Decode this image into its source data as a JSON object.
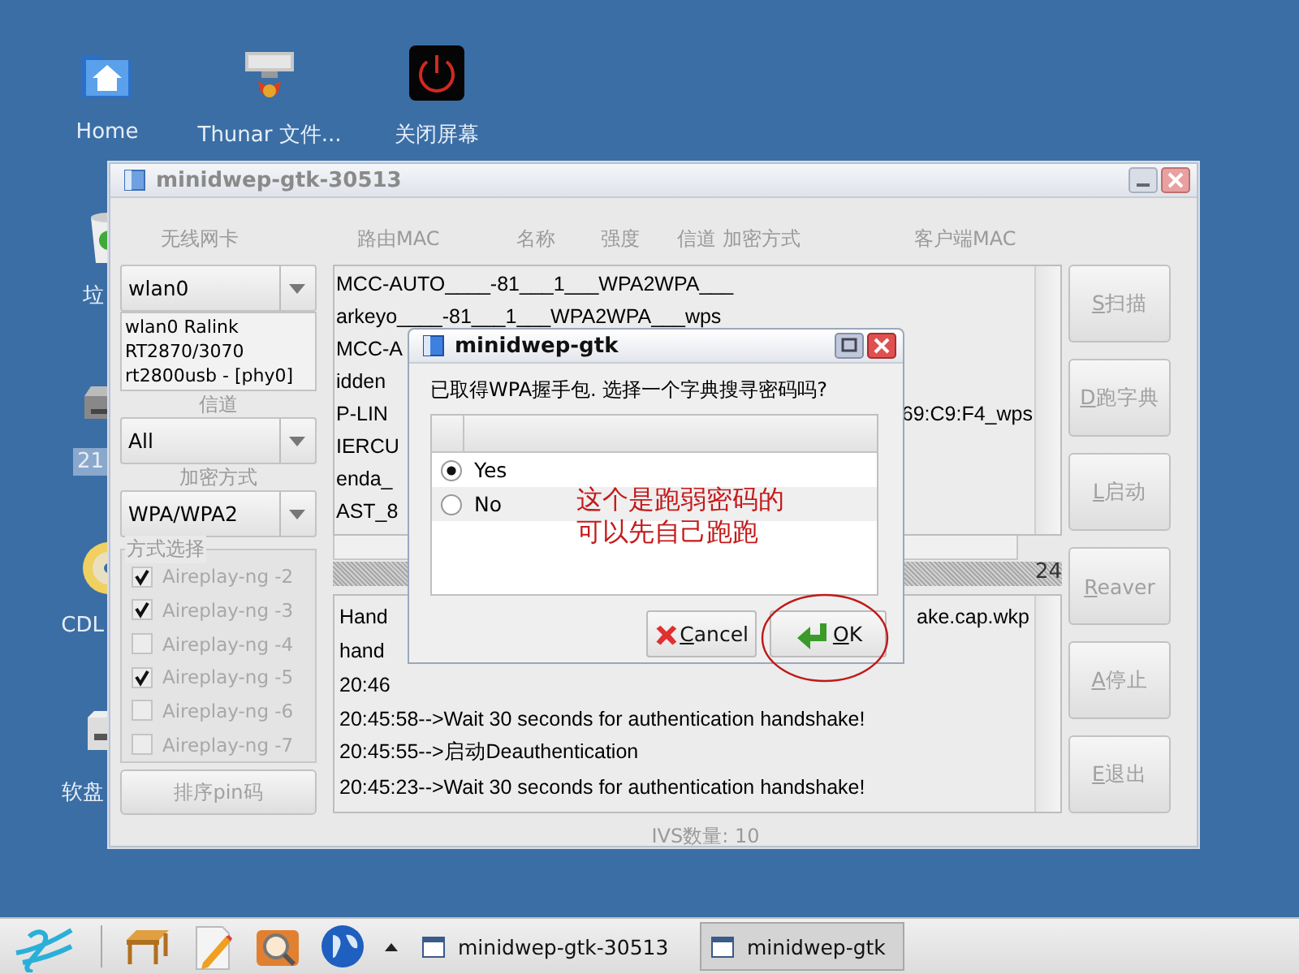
{
  "desktop_icons": [
    {
      "label": "Home",
      "kind": "home",
      "selected": false
    },
    {
      "label": "Thunar 文件...",
      "kind": "files",
      "selected": false
    },
    {
      "label": "关闭屏幕",
      "kind": "power",
      "selected": false
    }
  ],
  "desktop_side_icons": [
    {
      "label": "垃",
      "kind": "trash",
      "selected": false
    },
    {
      "label": "21",
      "kind": "drive",
      "selected": true
    },
    {
      "label": "CDL",
      "kind": "disc",
      "selected": false
    },
    {
      "label": "软盘",
      "kind": "floppy",
      "selected": false
    }
  ],
  "window": {
    "title": "minidwep-gtk-30513",
    "headers": [
      "无线网卡",
      "路由MAC",
      "名称",
      "强度",
      "信道",
      "加密方式",
      "客户端MAC"
    ],
    "interface": {
      "value": "wlan0",
      "info": [
        "wlan0 Ralink",
        "RT2870/3070",
        "rt2800usb - [phy0]"
      ]
    },
    "channel": {
      "label": "信道",
      "value": "All"
    },
    "encryption": {
      "label": "加密方式",
      "value": "WPA/WPA2"
    },
    "methods": {
      "label": "方式选择",
      "options": [
        {
          "label": "Aireplay-ng -2",
          "checked": true,
          "disabled": true
        },
        {
          "label": "Aireplay-ng -3",
          "checked": true,
          "disabled": true
        },
        {
          "label": "Aireplay-ng -4",
          "checked": false,
          "disabled": true
        },
        {
          "label": "Aireplay-ng -5",
          "checked": true,
          "disabled": true
        },
        {
          "label": "Aireplay-ng -6",
          "checked": false,
          "disabled": true
        },
        {
          "label": "Aireplay-ng -7",
          "checked": false,
          "disabled": true
        }
      ]
    },
    "pin_button": {
      "label": "排序pin码",
      "disabled": true
    },
    "networks": [
      {
        "text": "MCC-AUTO____-81___1___WPA2WPA___"
      },
      {
        "text": "arkeyo____-81___1___WPA2WPA___wps"
      },
      {
        "text": "MCC-A"
      },
      {
        "text": "idden"
      },
      {
        "text": "P-LIN",
        "tail": "69:C9:F4_wps"
      },
      {
        "text": "IERCU"
      },
      {
        "text": "enda_"
      },
      {
        "text": "AST_8"
      }
    ],
    "progress": {
      "text": "24",
      "level": 1
    },
    "log": [
      {
        "text": "Hand",
        "tail": "ake.cap.wkp"
      },
      {
        "text": "hand"
      },
      {
        "text": "20:46"
      },
      {
        "text": "20:45:58-->Wait 30 seconds for authentication handshake!"
      },
      {
        "text": "20:45:55-->启动Deauthentication"
      },
      {
        "text": "20:45:23-->Wait 30 seconds for authentication handshake!"
      }
    ],
    "status": "IVS数量: 10",
    "buttons": [
      {
        "label": "S扫描",
        "disabled": true
      },
      {
        "label": "D跑字典",
        "disabled": true
      },
      {
        "label": "L启动",
        "disabled": true
      },
      {
        "label": "Reaver",
        "disabled": true
      },
      {
        "label": "A停止",
        "disabled": true
      },
      {
        "label": "E退出",
        "disabled": true
      }
    ]
  },
  "dialog": {
    "title": "minidwep-gtk",
    "question": "已取得WPA握手包. 选择一个字典搜寻密码吗?",
    "options": [
      {
        "label": "Yes",
        "selected": true
      },
      {
        "label": "No",
        "selected": false
      }
    ],
    "buttons": [
      {
        "label": "Cancel",
        "kind": "cancel"
      },
      {
        "label": "OK",
        "kind": "ok"
      }
    ]
  },
  "annotation": {
    "lines": [
      "这个是跑弱密码的",
      "可以先自己跑跑"
    ]
  },
  "taskbar": {
    "launchers": [
      {
        "kind": "logo"
      },
      {
        "kind": "table"
      },
      {
        "kind": "pencil"
      },
      {
        "kind": "search"
      },
      {
        "kind": "globe"
      }
    ],
    "tasks": [
      {
        "label": "minidwep-gtk-30513",
        "selected": false
      },
      {
        "label": "minidwep-gtk",
        "selected": true
      }
    ]
  }
}
